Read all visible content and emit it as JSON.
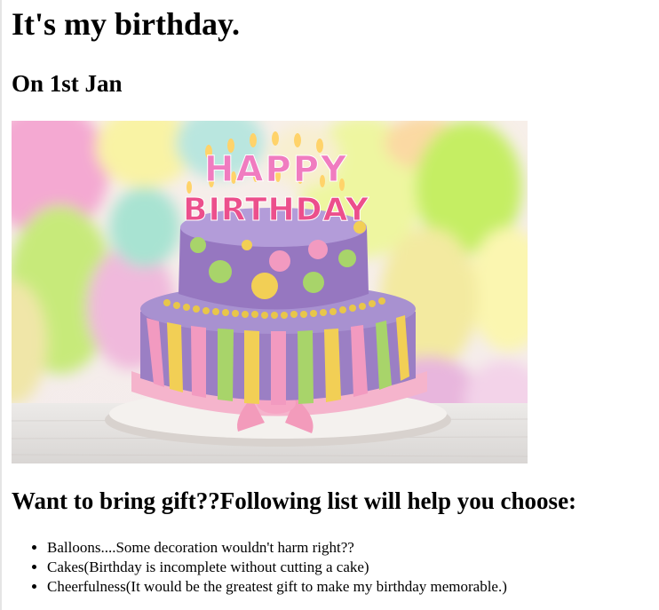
{
  "page": {
    "title": "It's my birthday.",
    "date": "On 1st Jan",
    "gift_heading": "Want to bring gift??Following list will help you choose:",
    "gift_list": [
      "Balloons....Some decoration wouldn't harm right??",
      "Cakes(Birthday is incomplete without cutting a cake)",
      "Cheerfulness(It would be the greatest gift to make my birthday memorable.)"
    ]
  },
  "cake_image": {
    "topper_line_1": "HAPPY",
    "topper_line_2": "BIRTHDAY",
    "colors": {
      "cake_purple": "#9b7fc4",
      "stripe_yellow": "#f2cf55",
      "stripe_green": "#a8d46a",
      "stripe_pink": "#f29ac0",
      "ribbon_pink": "#f5b4cc",
      "board_white": "#f4f1ee",
      "pearl_gold": "#e8c64a"
    }
  }
}
